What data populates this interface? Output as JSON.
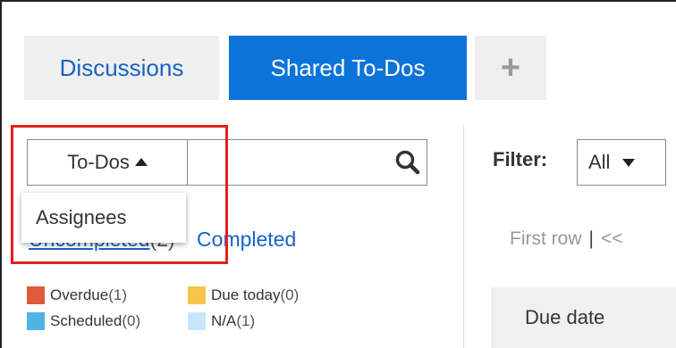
{
  "tabs": {
    "discussions": "Discussions",
    "shared_todos": "Shared To-Dos",
    "add": "+"
  },
  "search": {
    "selected_option": "To-Dos",
    "value": "",
    "placeholder": ""
  },
  "dropdown": {
    "options": [
      "Assignees"
    ]
  },
  "status": {
    "uncompleted_label": "Uncompleted",
    "uncompleted_count": "(2)",
    "completed_label": "Completed"
  },
  "legend": [
    {
      "label": "Overdue",
      "count": "(1)",
      "color": "#e05a3d"
    },
    {
      "label": "Due today",
      "count": "(0)",
      "color": "#f7c54a"
    },
    {
      "label": "Scheduled",
      "count": "(0)",
      "color": "#4fb3e8"
    },
    {
      "label": "N/A",
      "count": "(1)",
      "color": "#c8e6fa"
    }
  ],
  "filter": {
    "label": "Filter:",
    "value": "All"
  },
  "pager": {
    "first_row": "First row",
    "separator": "|",
    "prev": "<<"
  },
  "table": {
    "due_date_header": "Due date"
  },
  "colors": {
    "accent": "#0c73d8",
    "link": "#1a63c4",
    "highlight": "#e02020"
  }
}
